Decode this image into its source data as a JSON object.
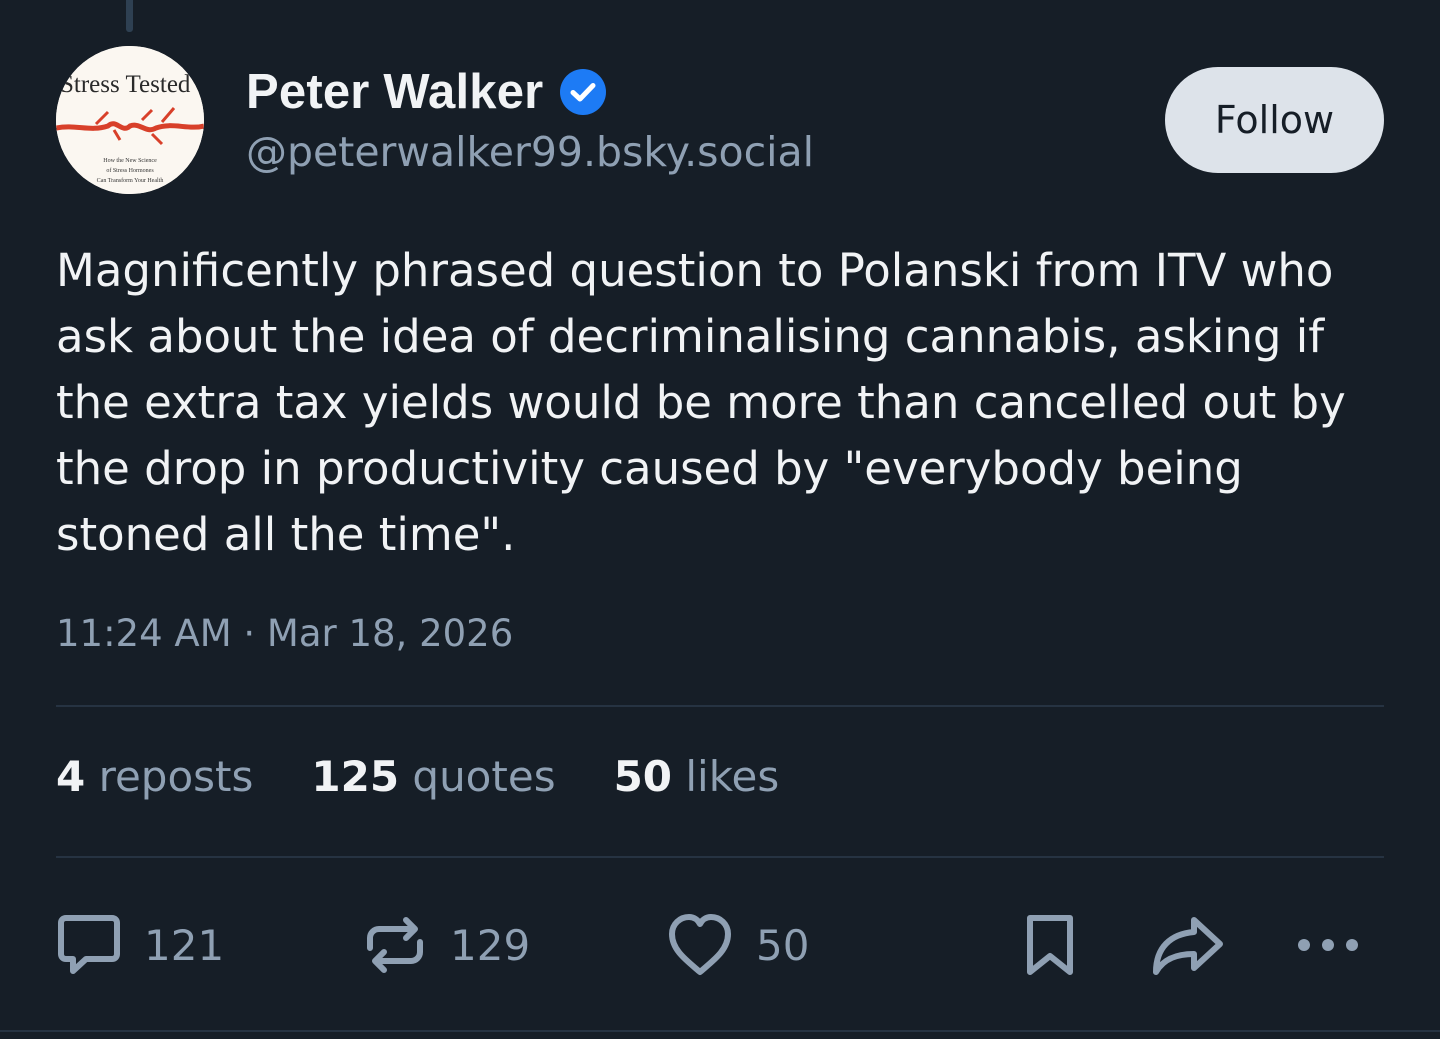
{
  "author": {
    "display_name": "Peter Walker",
    "handle": "@peterwalker99.bsky.social",
    "verified": true,
    "avatar": {
      "title_text": "Stress Tested",
      "subtitle_lines": [
        "How the New Science",
        "of Stress Hormones",
        "Can Transform Your Health"
      ]
    }
  },
  "follow_button": {
    "label": "Follow"
  },
  "post": {
    "text": "Magnificently phrased question to Polanski from ITV who ask about the idea of decriminalising cannabis, asking if the extra tax yields would be more than cancelled out by the drop in productivity caused by \"everybody being stoned all the time\".",
    "timestamp": "11:24 AM · Mar 18, 2026"
  },
  "stats": {
    "reposts": {
      "count": "4",
      "label": "reposts"
    },
    "quotes": {
      "count": "125",
      "label": "quotes"
    },
    "likes": {
      "count": "50",
      "label": "likes"
    }
  },
  "actions": {
    "reply_count": "121",
    "repost_count": "129",
    "like_count": "50"
  },
  "icons": [
    "chat-bubble-icon",
    "repost-icon",
    "heart-icon",
    "bookmark-icon",
    "share-arrow-icon",
    "ellipsis-icon",
    "verified-check-icon"
  ],
  "colors": {
    "background": "#161e27",
    "text_primary": "#f1f3f5",
    "text_secondary": "#8fa0b3",
    "verified_blue": "#1d7bf5",
    "follow_button_bg": "#dde3ea",
    "divider": "#263342"
  }
}
